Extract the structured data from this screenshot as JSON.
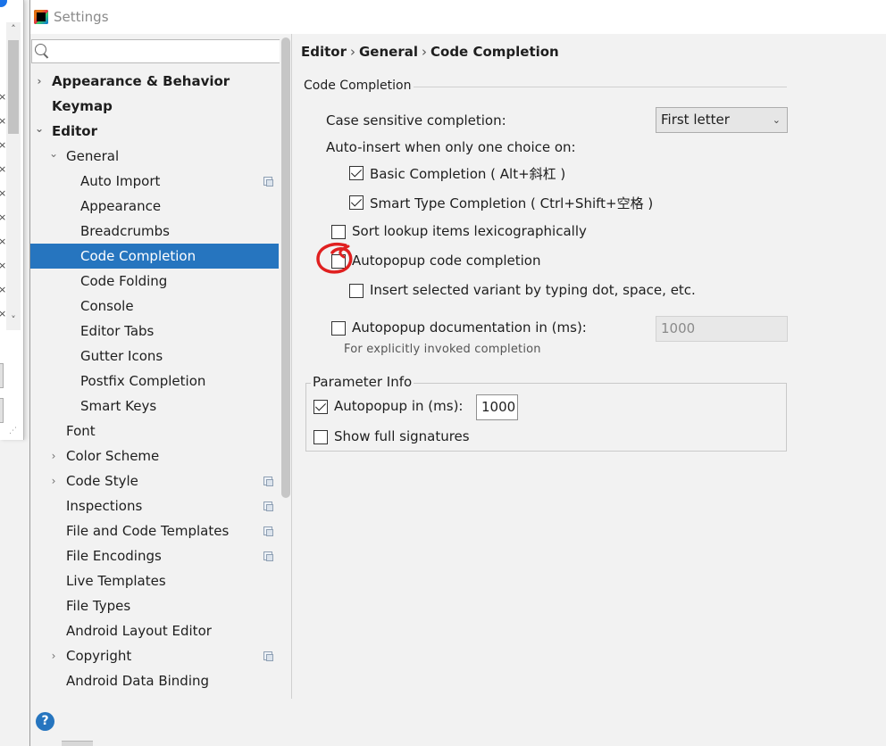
{
  "window": {
    "title": "Settings"
  },
  "search": {
    "placeholder": ""
  },
  "tree": {
    "items": [
      {
        "label": "Appearance & Behavior"
      },
      {
        "label": "Keymap"
      },
      {
        "label": "Editor"
      },
      {
        "label": "General"
      },
      {
        "label": "Auto Import"
      },
      {
        "label": "Appearance"
      },
      {
        "label": "Breadcrumbs"
      },
      {
        "label": "Code Completion"
      },
      {
        "label": "Code Folding"
      },
      {
        "label": "Console"
      },
      {
        "label": "Editor Tabs"
      },
      {
        "label": "Gutter Icons"
      },
      {
        "label": "Postfix Completion"
      },
      {
        "label": "Smart Keys"
      },
      {
        "label": "Font"
      },
      {
        "label": "Color Scheme"
      },
      {
        "label": "Code Style"
      },
      {
        "label": "Inspections"
      },
      {
        "label": "File and Code Templates"
      },
      {
        "label": "File Encodings"
      },
      {
        "label": "Live Templates"
      },
      {
        "label": "File Types"
      },
      {
        "label": "Android Layout Editor"
      },
      {
        "label": "Copyright"
      },
      {
        "label": "Android Data Binding"
      }
    ]
  },
  "breadcrumb": {
    "part1": "Editor",
    "part2": "General",
    "part3": "Code Completion",
    "sep": "›"
  },
  "code_completion": {
    "group_title": "Code Completion",
    "case_sensitive_label": "Case sensitive completion:",
    "case_sensitive_value": "First letter",
    "auto_insert_label": "Auto-insert when only one choice on:",
    "basic_completion": {
      "label": "Basic Completion ( Alt+斜杠 )",
      "checked": true
    },
    "smart_type_completion": {
      "label": "Smart Type Completion ( Ctrl+Shift+空格 )",
      "checked": true
    },
    "sort_lexicographically": {
      "label": "Sort lookup items lexicographically",
      "checked": false
    },
    "autopopup_completion": {
      "label": "Autopopup code completion",
      "checked": false
    },
    "insert_selected_variant": {
      "label": "Insert selected variant by typing dot, space, etc.",
      "checked": false
    },
    "autopopup_documentation": {
      "label": "Autopopup documentation in (ms):",
      "checked": false,
      "value": "1000"
    },
    "explicit_hint": "For explicitly invoked completion"
  },
  "parameter_info": {
    "title": "Parameter Info",
    "autopopup": {
      "label": "Autopopup in (ms):",
      "checked": true,
      "value": "1000"
    },
    "show_full_signatures": {
      "label": "Show full signatures",
      "checked": false
    }
  },
  "icons": {
    "help": "?",
    "expand_right": "›",
    "expand_down": "⌄",
    "dropdown": "⌄"
  },
  "colors": {
    "selection": "#2675bf",
    "annotation_red": "#e02020"
  }
}
